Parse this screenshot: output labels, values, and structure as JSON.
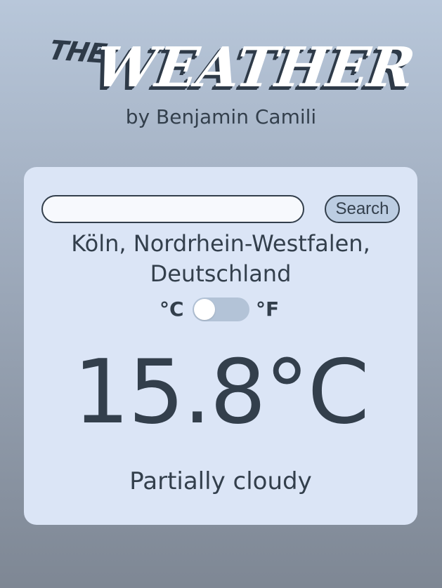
{
  "header": {
    "logo_small": "THE",
    "logo_main": "WEATHER",
    "byline": "by Benjamin Camili"
  },
  "search": {
    "value": "",
    "placeholder": "",
    "button_label": "Search"
  },
  "location": {
    "line1": "Köln, Nordrhein-Westfalen,",
    "line2": "Deutschland"
  },
  "units": {
    "celsius_label": "°C",
    "fahrenheit_label": "°F",
    "selected": "celsius"
  },
  "weather": {
    "temperature": "15.8°C",
    "condition": "Partially cloudy"
  },
  "colors": {
    "text": "#333f4c",
    "card_background": "#dbe5f6",
    "toggle_track": "#b3c3d7",
    "button_background": "#bccde2"
  }
}
